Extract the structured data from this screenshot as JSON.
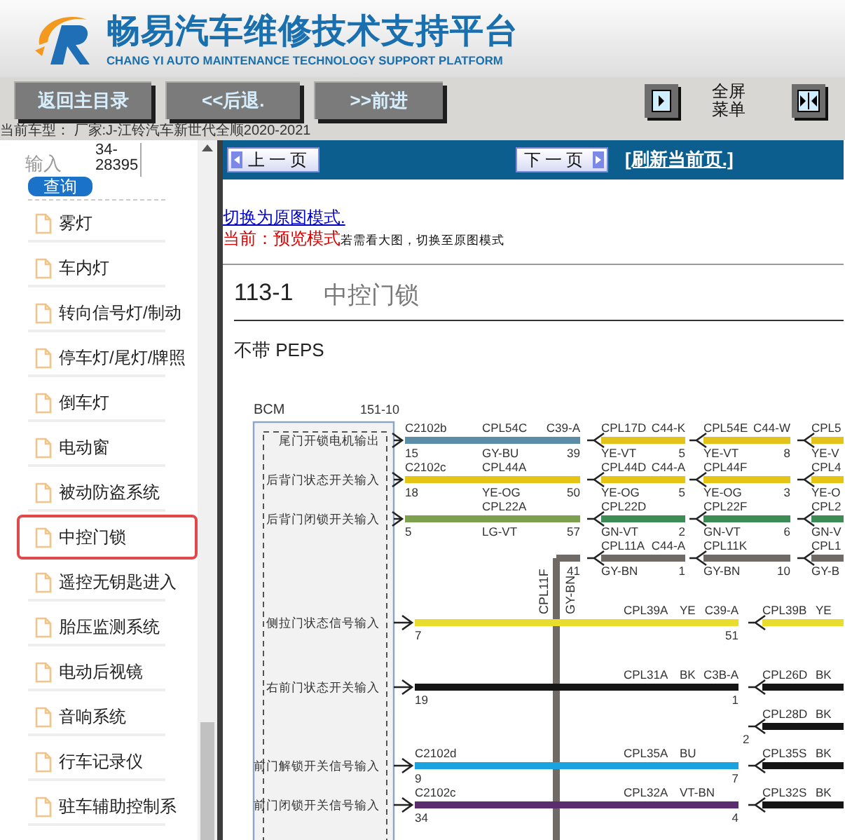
{
  "header": {
    "title": "畅易汽车维修技术支持平台",
    "subtitle": "CHANG YI AUTO MAINTENANCE TECHNOLOGY SUPPORT PLATFORM"
  },
  "toolbar": {
    "buttons": [
      "返回主目录",
      "<<后退.",
      ">>前进"
    ],
    "fullscreen_label": "全屏菜单"
  },
  "vehicle": "当前车型：  厂家:J-江铃汽车新世代全顺2020-2021",
  "sidebar": {
    "search": {
      "placeholder": "输入",
      "value": "34-28395",
      "button": "查询"
    },
    "items": [
      {
        "label": "雾灯",
        "selected": false
      },
      {
        "label": "车内灯",
        "selected": false
      },
      {
        "label": "转向信号灯/制动",
        "selected": false
      },
      {
        "label": "停车灯/尾灯/牌照",
        "selected": false
      },
      {
        "label": "倒车灯",
        "selected": false
      },
      {
        "label": "电动窗",
        "selected": false
      },
      {
        "label": "被动防盗系统",
        "selected": false
      },
      {
        "label": "中控门锁",
        "selected": true
      },
      {
        "label": "遥控无钥匙进入",
        "selected": false
      },
      {
        "label": "胎压监测系统",
        "selected": false
      },
      {
        "label": "电动后视镜",
        "selected": false
      },
      {
        "label": "音响系统",
        "selected": false
      },
      {
        "label": "行车记录仪",
        "selected": false
      },
      {
        "label": "驻车辅助控制系",
        "selected": false
      }
    ]
  },
  "viewer": {
    "prev": "上一页",
    "next": "下一页",
    "refresh": "[刷新当前页.]",
    "mode_link": "切换为原图模式.",
    "mode_label": "当前：",
    "mode_value": "预览模式",
    "mode_hint": "若需看大图，切换至原图模式",
    "section_number": "113-1",
    "section_title": "中控门锁",
    "subtitle": "不带 PEPS",
    "diagram": {
      "module": "BCM",
      "page_ref": "151-10",
      "rows": [
        {
          "kind": "bcm",
          "label": "尾门开锁电机输出",
          "segments": [
            {
              "color": "#5b8ea6",
              "from_connector": "C2102b",
              "circuit": "CPL54C",
              "to_connector": "C39-A",
              "from_pin": "15",
              "code": "GY-BU",
              "to_pin": "39"
            },
            {
              "color": "#e3c21c",
              "circuit": "CPL17D",
              "to_connector": "C44-K",
              "code": "YE-VT",
              "to_pin": "5"
            },
            {
              "color": "#e3c21c",
              "circuit": "CPL54E",
              "to_connector": "C44-W",
              "code": "YE-VT",
              "to_pin": "8"
            },
            {
              "color": "#e3c21c",
              "circuit": "CPL5",
              "code": "YE-V"
            }
          ]
        },
        {
          "kind": "bcm",
          "label": "后背门状态开关输入",
          "segments": [
            {
              "color": "#e6c414",
              "from_connector": "C2102c",
              "circuit": "CPL44A",
              "from_pin": "18",
              "code": "YE-OG",
              "to_pin": "50"
            },
            {
              "color": "#e6c414",
              "circuit": "CPL44D",
              "to_connector": "C44-A",
              "code": "YE-OG",
              "to_pin": "5"
            },
            {
              "color": "#e6c414",
              "circuit": "CPL44F",
              "code": "YE-OG",
              "to_pin": "3"
            },
            {
              "color": "#e6c414",
              "circuit": "CPL4",
              "code": "YE-O"
            }
          ]
        },
        {
          "kind": "bcm",
          "label": "后背门闭锁开关输入",
          "segments": [
            {
              "color": "#7da04e",
              "circuit": "CPL22A",
              "from_pin": "5",
              "code": "LG-VT",
              "to_pin": "57"
            },
            {
              "color": "#3d8c55",
              "circuit": "CPL22D",
              "code": "GN-VT",
              "to_pin": "2"
            },
            {
              "color": "#3d8c55",
              "circuit": "CPL22F",
              "code": "GN-VT",
              "to_pin": "6"
            },
            {
              "color": "#3d8c55",
              "circuit": "CPL2",
              "code": "GN-V"
            }
          ]
        },
        {
          "kind": "branch",
          "branch": {
            "circuit": "CPL11F",
            "code": "GY-BN"
          },
          "segments": [
            {
              "color": "#706a66",
              "to_pin": "41"
            },
            {
              "color": "#706a66",
              "circuit": "CPL11A",
              "to_connector": "C44-A",
              "code": "GY-BN",
              "to_pin": "1"
            },
            {
              "color": "#706a66",
              "circuit": "CPL11K",
              "code": "GY-BN",
              "to_pin": "10"
            },
            {
              "color": "#706a66",
              "circuit": "CPL1",
              "code": "GY-B"
            }
          ]
        },
        {
          "kind": "long",
          "label": "侧拉门状态信号输入",
          "segments": [
            {
              "color": "#e8dc2c",
              "from_pin": "7",
              "circuit": "CPL39A",
              "code": "YE",
              "to_connector": "C39-A",
              "to_pin": "51"
            },
            {
              "color": "#e8dc2c",
              "circuit": "CPL39B",
              "code": "YE"
            }
          ]
        },
        {
          "kind": "long",
          "label": "右前门状态开关输入",
          "segments": [
            {
              "color": "#151515",
              "from_pin": "19",
              "circuit": "CPL31A",
              "code": "BK",
              "to_connector": "C3B-A",
              "to_pin": "1"
            },
            {
              "color": "#151515",
              "circuit": "CPL26D",
              "code": "BK"
            }
          ]
        },
        {
          "kind": "stub",
          "segments": [
            {
              "color": "#151515",
              "from_pin": "2",
              "circuit": "CPL28D",
              "code": "BK"
            }
          ]
        },
        {
          "kind": "long",
          "label": "前门解锁开关信号输入",
          "segments": [
            {
              "color": "#1ba3df",
              "from_connector": "C2102d",
              "from_pin": "9",
              "circuit": "CPL35A",
              "code": "BU",
              "to_pin": "7"
            },
            {
              "color": "#151515",
              "circuit": "CPL35S",
              "code": "BK"
            }
          ]
        },
        {
          "kind": "long",
          "label": "前门闭锁开关信号输入",
          "segments": [
            {
              "color": "#5b2d6f",
              "from_connector": "C2102c",
              "from_pin": "34",
              "circuit": "CPL32A",
              "code": "VT-BN",
              "to_pin": "4"
            },
            {
              "color": "#151515",
              "circuit": "CPL32S",
              "code": "BK"
            }
          ]
        }
      ]
    }
  }
}
